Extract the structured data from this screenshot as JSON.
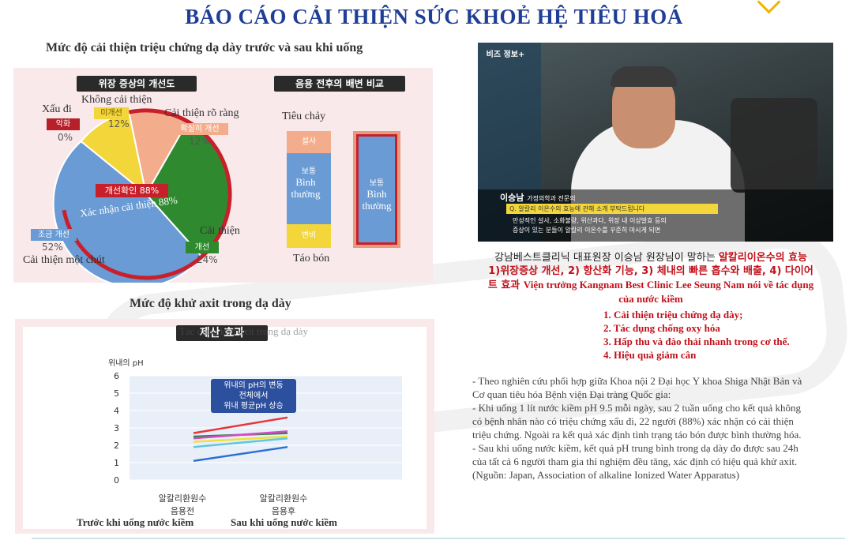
{
  "title": "BÁO CÁO CẢI THIỆN SỨC KHOẺ HỆ TIÊU HOÁ",
  "pie_section": {
    "heading": "Mức độ cải thiện triệu chứng dạ dày  trước và sau khi uống",
    "chart_title_ko": "위장 증상의 개선도",
    "labels": {
      "worse": {
        "vi": "Xấu đi",
        "ko": "악화",
        "pct": "0%"
      },
      "no_change": {
        "vi": "Không cải thiện",
        "ko": "미개선",
        "pct": "12%"
      },
      "clear": {
        "vi": "Cải thiện rõ ràng",
        "ko": "확실히 개선",
        "pct": "12%"
      },
      "slight": {
        "vi": "Cải thiện một chút",
        "ko": "조금 개선",
        "pct": "52%"
      },
      "improve": {
        "vi": "Cải thiện",
        "ko": "개선",
        "pct": "24%"
      }
    },
    "confirm_ko": "개선확인 88%",
    "confirm_vi": "Xác nhận cải thiện 88%"
  },
  "bar_section": {
    "chart_title_ko": "음용 전후의 배변 비교",
    "top_label": "Tiêu chảy",
    "bottom_label": "Táo bón",
    "before": {
      "top_ko": "설사",
      "mid_ko": "보통",
      "mid_vi": "Bình thường",
      "bottom_ko": "변비"
    },
    "after": {
      "mid_ko": "보통",
      "mid_vi": "Bình thường"
    }
  },
  "ph_section": {
    "heading": "Mức độ khử axit trong dạ dày",
    "chart_title_ko": "제산 효과",
    "chart_title_vi": "Tác dụng khử axit trong dạ dày",
    "ylabel": "위내의 pH",
    "note_ko_1": "위내의 pH의 변동",
    "note_ko_2": "전체에서",
    "note_ko_3": "위내 평균pH 상승",
    "x_before_ko_1": "알칼리환원수",
    "x_before_ko_2": "음용전",
    "x_after_ko_1": "알칼리환원수",
    "x_after_ko_2": "음용후",
    "x_before_vi": "Trước khi uống nước kiềm",
    "x_after_vi": "Sau khi uống nước kiềm"
  },
  "chart_data": {
    "type": "line",
    "title": "제산 효과",
    "ylabel": "위내의 pH",
    "ylim": [
      0,
      6
    ],
    "yticks": [
      "0",
      "1",
      "2",
      "3",
      "4",
      "5",
      "6"
    ],
    "x": [
      "알칼리환원수 음용전",
      "알칼리환원수 음용후"
    ],
    "series": [
      {
        "values": [
          2.7,
          3.6
        ],
        "color": "#e8343c"
      },
      {
        "values": [
          2.5,
          2.7
        ],
        "color": "#2e8b3a"
      },
      {
        "values": [
          2.4,
          2.8
        ],
        "color": "#d44ac8"
      },
      {
        "values": [
          2.2,
          2.5
        ],
        "color": "#f0e03c"
      },
      {
        "values": [
          1.9,
          2.4
        ],
        "color": "#5fc7e0"
      },
      {
        "values": [
          1.1,
          1.9
        ],
        "color": "#2b6fd6"
      }
    ]
  },
  "video": {
    "logo_ko": "비즈 정보+",
    "name_ko": "이승남",
    "role_ko": "가정의학과 전문의",
    "question_ko": "Q. 알칼리 이온수의 효능에 관해 소개 부탁드립니다",
    "answer_ko_1": "만성적인 설사, 소화불량, 위산과다, 위장 내 이상발효 등의",
    "answer_ko_2": "증상이 있는 분들이 알칼리 이온수를 꾸준히 마시게 되면"
  },
  "caption": {
    "line1_ko": "강남베스트클리닉 대표원장 이승남 원장님이 말하는 ",
    "line1_red": "알칼리이온수의 효능",
    "line2_red": "1)위장증상 개선, 2) 항산화 기능, 3) 체내의 빠른 흡수와 배출, 4) 다이어",
    "line3_red_ko": "트 효과 ",
    "line3_red_vi": "Viện trưởng Kangnam Best Clinic Lee Seung Nam nói về tác dụng",
    "line4_red": "của nước kiềm",
    "items": [
      "1.    Cải thiện triệu chứng dạ dày;",
      "2.    Tác dụng chống oxy hóa",
      "3.    Hấp thu và đào thải nhanh trong cơ thể.",
      "4.    Hiệu quả giảm cân"
    ]
  },
  "research": {
    "p1": "- Theo nghiên cứu phối hợp giữa Khoa nội 2 Đại học Y khoa Shiga Nhật Bản và Cơ quan tiêu hóa Bệnh viện Đại tràng Quốc gia:",
    "p2": "-  Khi uống 1 lít nước kiềm pH 9.5 mỗi ngày, sau 2 tuần uống cho kết quả không có bệnh nhân nào có triệu chứng xấu đi, 22 người (88%) xác nhận có cải thiện triệu chứng. Ngoài ra kết quả xác định tình trạng táo bón được bình thường hóa.",
    "p3": "- Sau khi uống nước kiềm, kết quả pH trung bình trong dạ dày đo được sau 24h của tất cả 6 người tham gia thí nghiệm đều tăng, xác định có hiệu quả khử axit.",
    "p4": "(Nguồn: Japan, Association of alkaline Ionized Water Apparatus)"
  }
}
